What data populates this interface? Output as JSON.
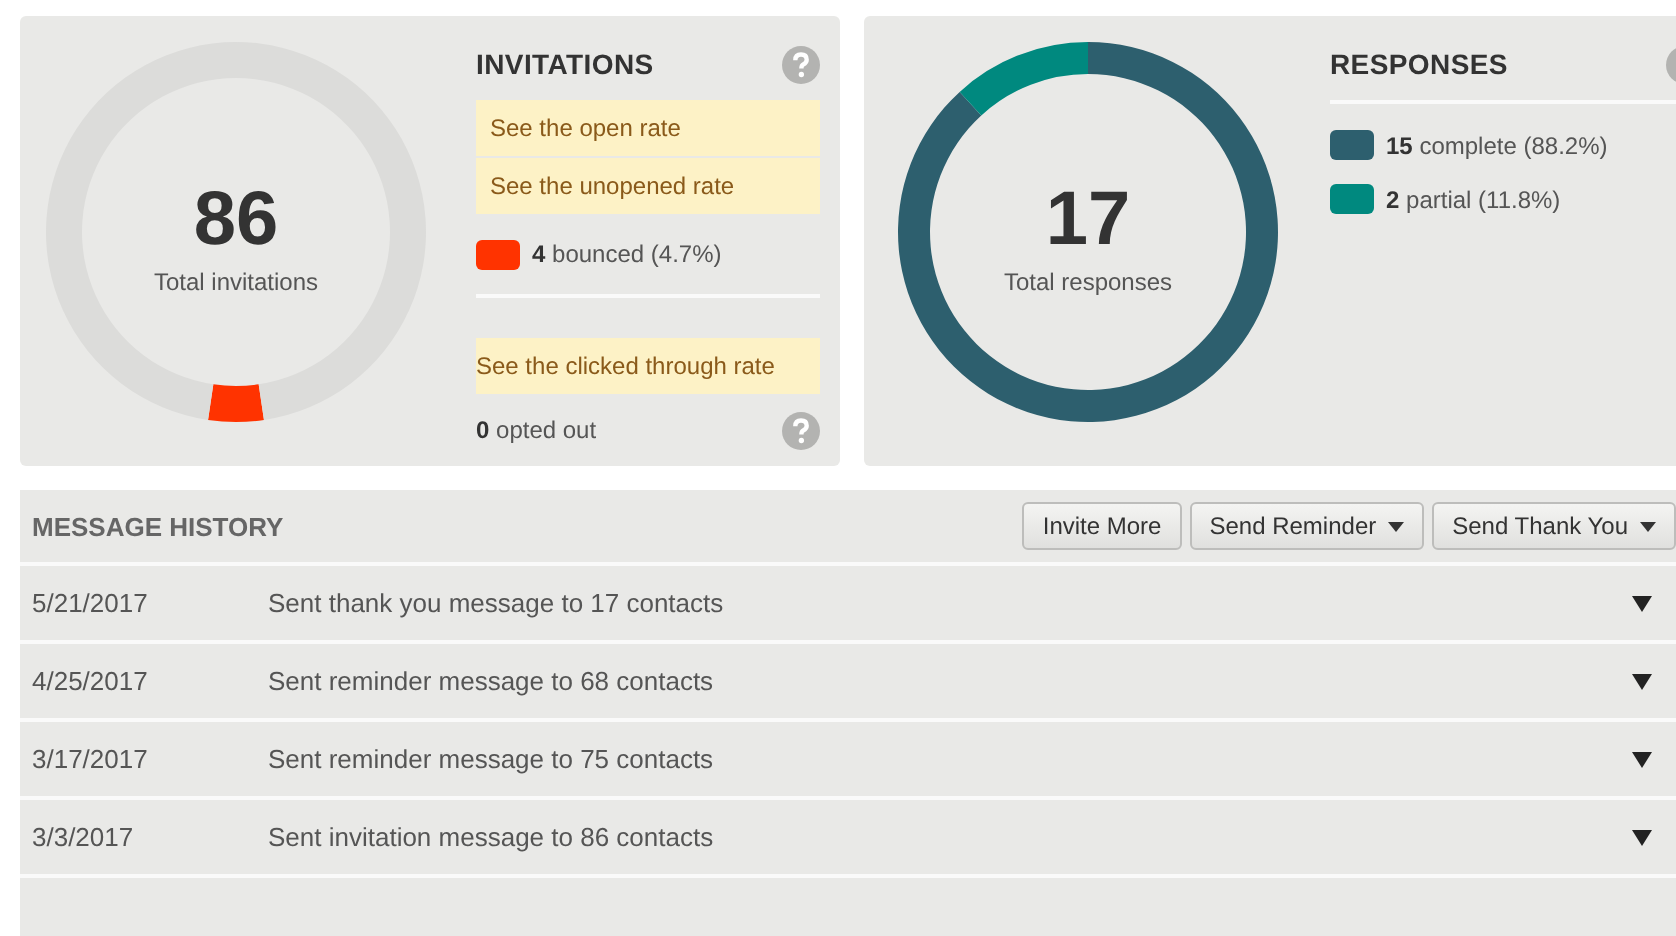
{
  "invitations": {
    "title": "INVITATIONS",
    "total": "86",
    "total_label": "Total invitations",
    "chart_data": {
      "type": "donut",
      "values": [
        4.7,
        95.3
      ]
    },
    "rate_links": [
      "See the open rate",
      "See the unopened rate"
    ],
    "bounced": {
      "text": "**4** bounced (4.7%)",
      "color": "#ff3300"
    },
    "clicked_link": "See the clicked through rate",
    "opted_out": "**0** opted out"
  },
  "responses": {
    "title": "RESPONSES",
    "total": "17",
    "total_label": "Total responses",
    "chart_data": {
      "type": "donut",
      "values": [
        88.2,
        11.8
      ]
    },
    "legend": [
      {
        "text": "**15** complete (88.2%)",
        "color": "#2d5f6e"
      },
      {
        "text": "**2** partial (11.8%)",
        "color": "#00897f"
      }
    ]
  },
  "history": {
    "title": "MESSAGE HISTORY",
    "buttons": [
      {
        "label": "Invite More",
        "dropdown": false
      },
      {
        "label": "Send Reminder",
        "dropdown": true
      },
      {
        "label": "Send Thank You",
        "dropdown": true
      }
    ],
    "rows": [
      {
        "date": "5/21/2017",
        "message": "Sent thank you message to 17 contacts"
      },
      {
        "date": "4/25/2017",
        "message": "Sent reminder message to 68 contacts"
      },
      {
        "date": "3/17/2017",
        "message": "Sent reminder message to 75 contacts"
      },
      {
        "date": "3/3/2017",
        "message": "Sent invitation message to 86 contacts"
      }
    ]
  }
}
